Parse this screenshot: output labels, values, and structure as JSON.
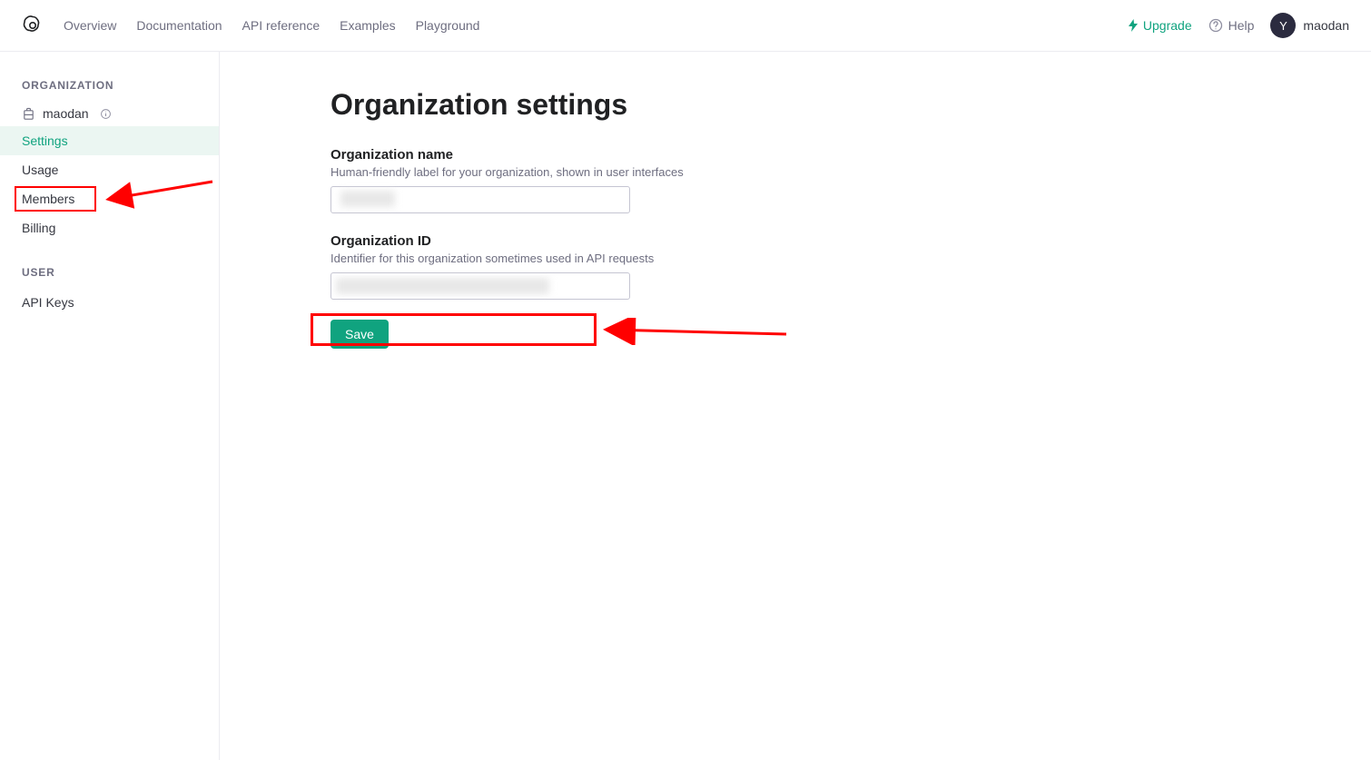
{
  "header": {
    "nav": {
      "overview": "Overview",
      "documentation": "Documentation",
      "api_reference": "API reference",
      "examples": "Examples",
      "playground": "Playground"
    },
    "upgrade": "Upgrade",
    "help": "Help",
    "user": {
      "initial": "Y",
      "name": "maodan"
    }
  },
  "sidebar": {
    "section_org": "ORGANIZATION",
    "org_name": "maodan",
    "items": {
      "settings": "Settings",
      "usage": "Usage",
      "members": "Members",
      "billing": "Billing"
    },
    "section_user": "USER",
    "user_items": {
      "api_keys": "API Keys"
    }
  },
  "main": {
    "title": "Organization settings",
    "org_name_label": "Organization name",
    "org_name_desc": "Human-friendly label for your organization, shown in user interfaces",
    "org_id_label": "Organization ID",
    "org_id_desc": "Identifier for this organization sometimes used in API requests",
    "save": "Save"
  }
}
